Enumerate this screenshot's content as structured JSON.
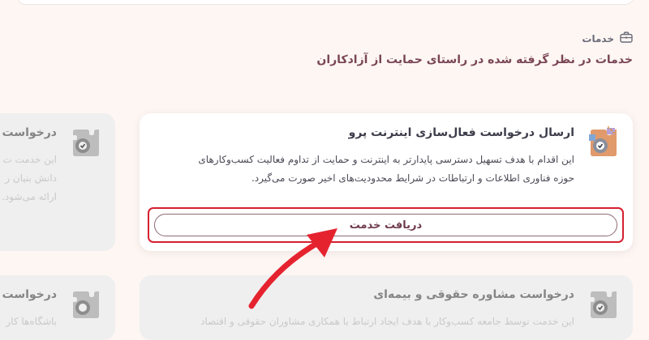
{
  "section": {
    "icon": "briefcase-icon",
    "title": "خدمات",
    "subtitle": "خدمات در نظر گرفته شده در راستای حمایت از آزادکاران"
  },
  "cards": {
    "active": {
      "icon": "puzzle-gear-icon",
      "title": "ارسال درخواست فعال‌سازی اینترنت پرو",
      "desc_lines": [
        "این اقدام با هدف تسهیل دسترسی پایدارتر به اینترنت و حمایت از تداوم فعالیت کسب‌وکارهای",
        "حوزه فناوری اطلاعات و ارتباطات در شرایط محدودیت‌های اخیر صورت می‌گیرد."
      ],
      "button_label": "دریافت خدمت"
    },
    "left_top": {
      "title": "درخواست م",
      "desc_lines": [
        "این خدمت ت",
        "دانش بنیان ر",
        "ارائه می‌شود."
      ]
    },
    "left_bottom": {
      "title": "درخواست ا",
      "desc_lines": [
        "باشگاه‌ها کار"
      ]
    },
    "bottom_main": {
      "title": "درخواست مشاوره حقوقی و بیمه‌ای",
      "desc_lines": [
        "این خدمت توسط جامعه کسب‌وکار با هدف ایجاد ارتباط با همکاری مشاوران حقوقی و اقتصاد"
      ]
    }
  },
  "colors": {
    "highlight": "#d52030",
    "arrow": "#e5232f",
    "title": "#7a4656"
  }
}
